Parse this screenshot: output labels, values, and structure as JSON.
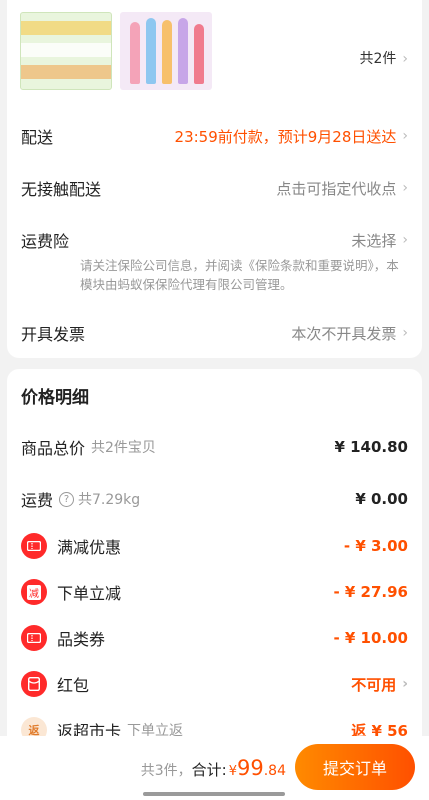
{
  "products": {
    "count_label": "共2件"
  },
  "delivery": {
    "shipping_label": "配送",
    "shipping_value": "23:59前付款，预计9月28日送达",
    "contactless_label": "无接触配送",
    "contactless_value": "点击可指定代收点",
    "insurance_label": "运费险",
    "insurance_value": "未选择",
    "insurance_note": "请关注保险公司信息，并阅读《保险条款和重要说明》，本模块由蚂蚁保保险代理有限公司管理。",
    "invoice_label": "开具发票",
    "invoice_value": "本次不开具发票"
  },
  "price_detail": {
    "title": "价格明细",
    "goods_label": "商品总价",
    "goods_sub": "共2件宝贝",
    "goods_value": "¥ 140.80",
    "freight_label": "运费",
    "freight_sub": "共7.29kg",
    "freight_value": "¥ 0.00",
    "full_reduction_label": "满减优惠",
    "full_reduction_value": "- ¥ 3.00",
    "instant_label": "下单立减",
    "instant_icon_text": "减",
    "instant_value": "- ¥ 27.96",
    "category_label": "品类券",
    "category_value": "- ¥ 10.00",
    "redpacket_label": "红包",
    "redpacket_value": "不可用",
    "cashback_label": "返超市卡",
    "cashback_icon_text": "返",
    "cashback_sub": "下单立返",
    "cashback_value": "返 ¥ 56"
  },
  "bottom": {
    "items_label": "共3件，",
    "total_label": "合计:",
    "currency": "¥",
    "total_int": "99",
    "total_dec": ".84",
    "submit_label": "提交订单"
  },
  "colors": {
    "accent": "#ff5000",
    "icon_red": "#ff2a2a"
  }
}
